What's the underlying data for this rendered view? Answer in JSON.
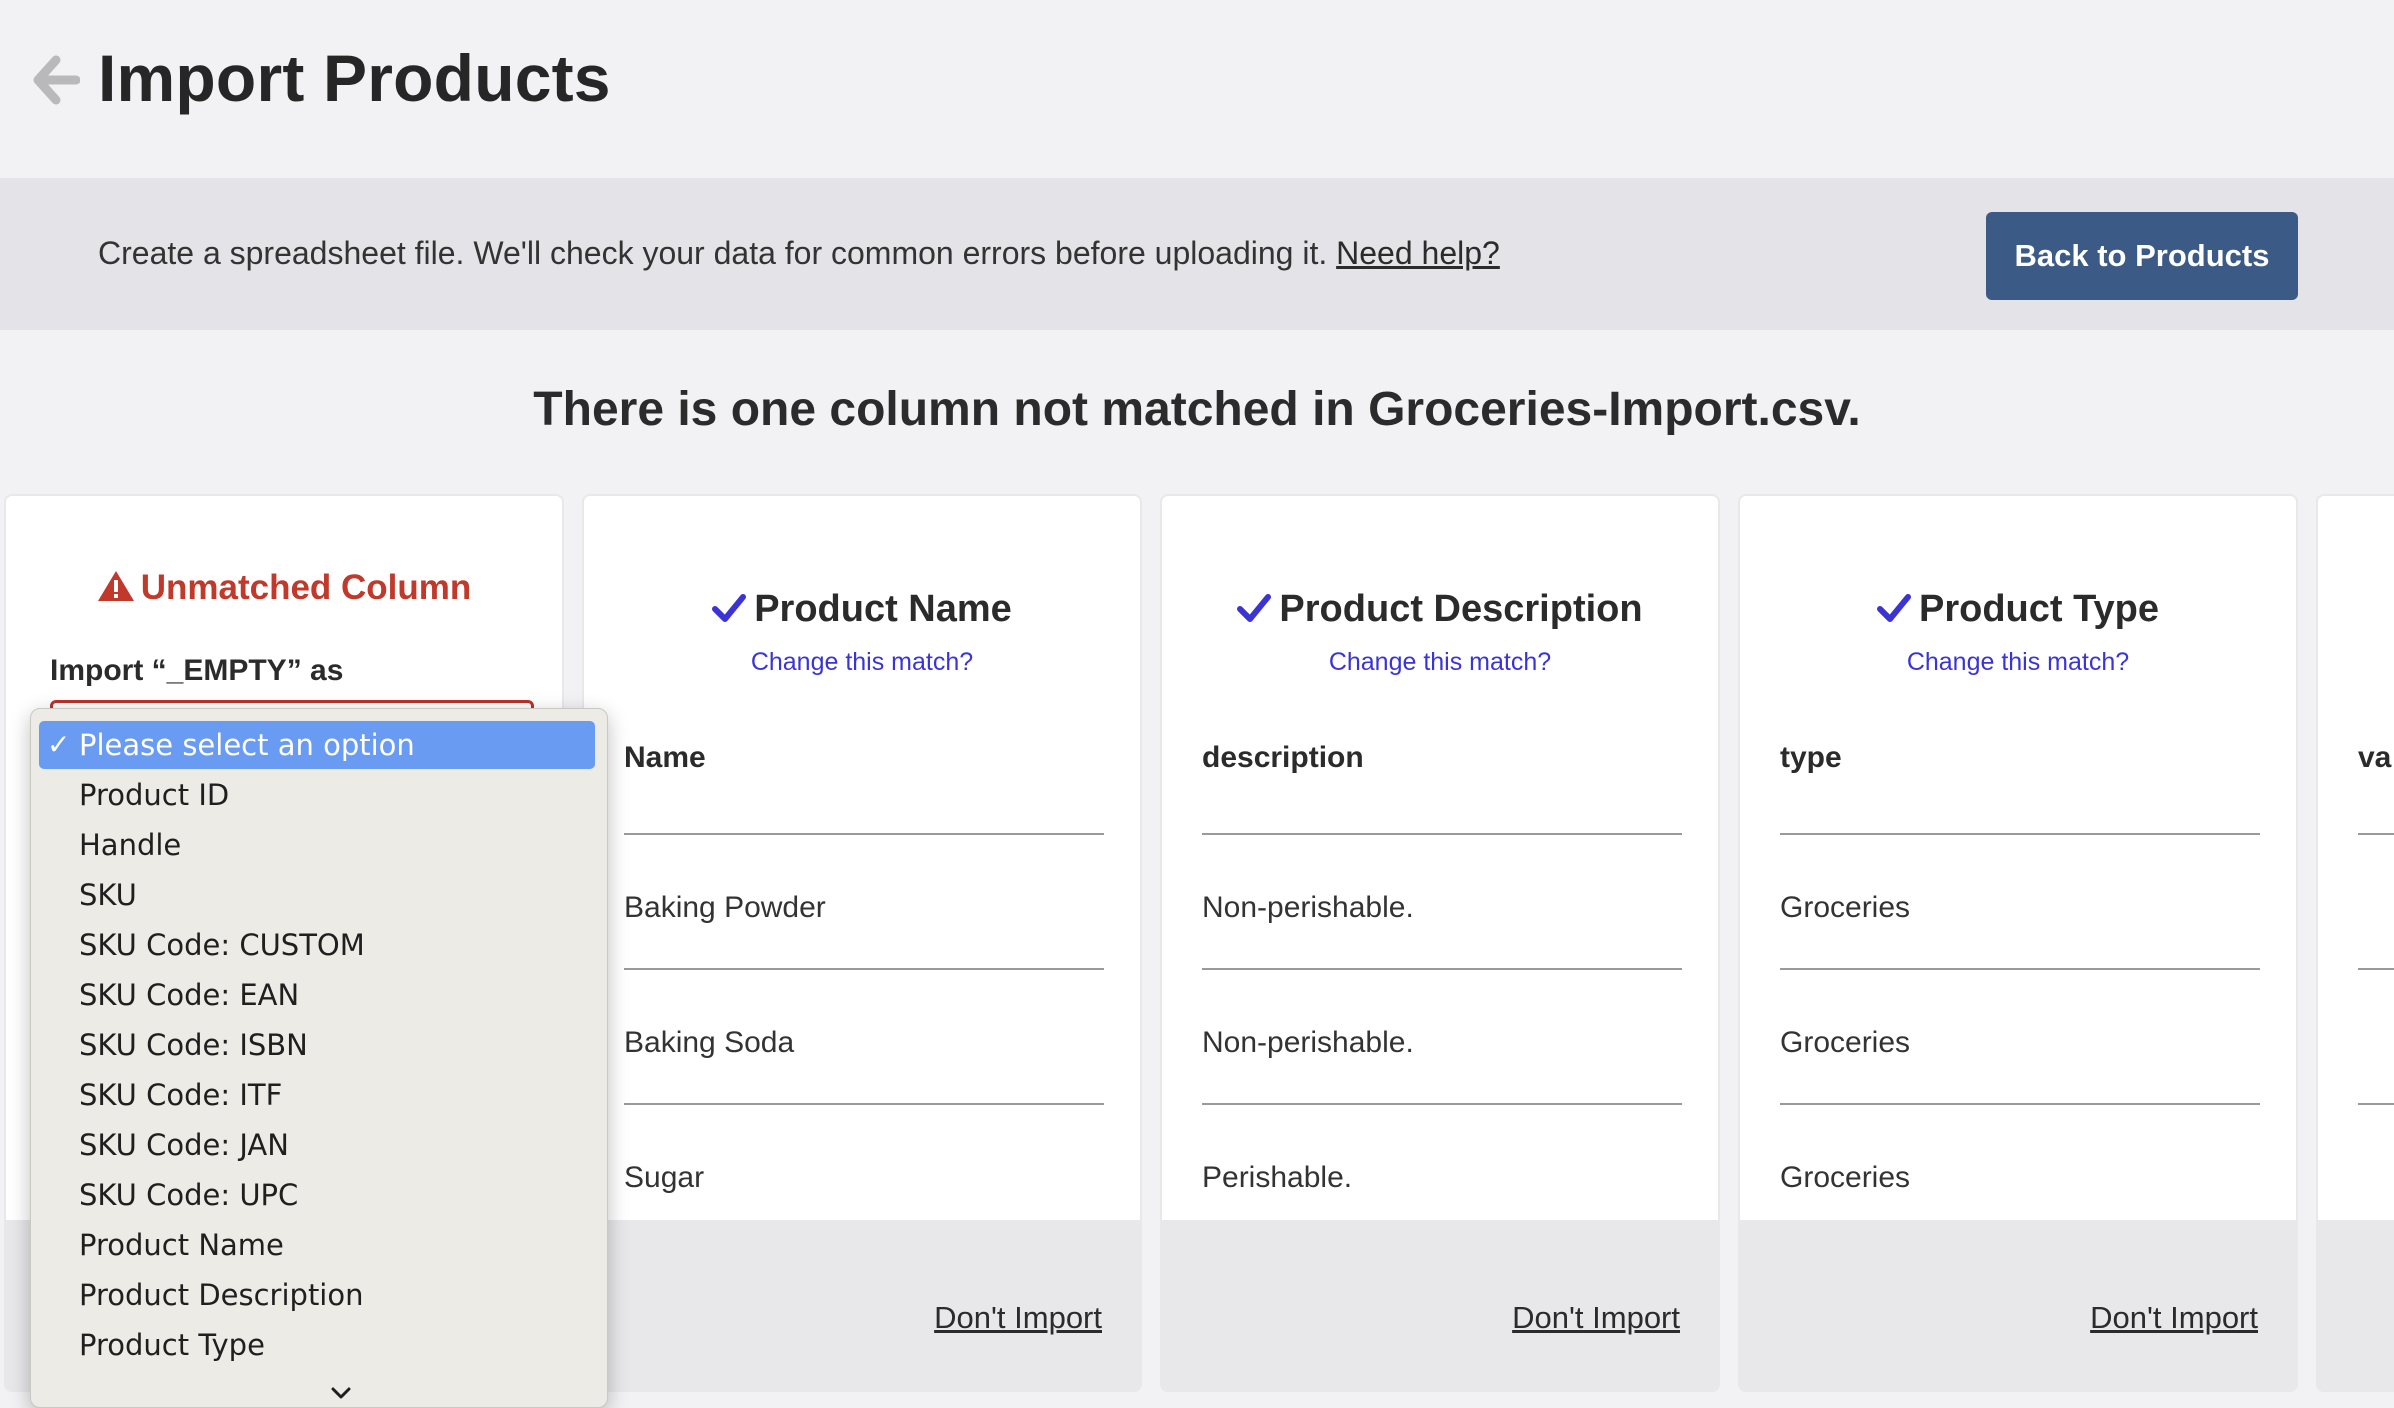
{
  "header": {
    "title": "Import Products"
  },
  "info_bar": {
    "text": "Create a spreadsheet file. We'll check your data for common errors before uploading it.",
    "help_link": "Need help?",
    "back_button": "Back to Products"
  },
  "status_heading": "There is one column not matched in Groceries-Import.csv.",
  "unmatched": {
    "title": "Unmatched Column",
    "import_label": "Import “_EMPTY” as"
  },
  "columns": [
    {
      "title": "Product Name",
      "change_link": "Change this match?",
      "header": "Name",
      "values": [
        "Baking Powder",
        "Baking Soda",
        "Sugar"
      ],
      "dont_import": "Don't Import"
    },
    {
      "title": "Product Description",
      "change_link": "Change this match?",
      "header": "description",
      "values": [
        "Non-perishable.",
        "Non-perishable.",
        "Perishable."
      ],
      "dont_import": "Don't Import"
    },
    {
      "title": "Product Type",
      "change_link": "Change this match?",
      "header": "type",
      "values": [
        "Groceries",
        "Groceries",
        "Groceries"
      ],
      "dont_import": "Don't Import"
    },
    {
      "header": "va"
    }
  ],
  "dropdown": {
    "selected_check": "✓",
    "options": [
      "Please select an option",
      "Product ID",
      "Handle",
      "SKU",
      "SKU Code: CUSTOM",
      "SKU Code: EAN",
      "SKU Code: ISBN",
      "SKU Code: ITF",
      "SKU Code: JAN",
      "SKU Code: UPC",
      "Product Name",
      "Product Description",
      "Product Type"
    ]
  },
  "colors": {
    "accent_button": "#3b5a85",
    "link_blue": "#3a34d6",
    "check_blue": "#3a34d6",
    "warning_red": "#c0392b",
    "selected_option": "#6a9bf2"
  }
}
